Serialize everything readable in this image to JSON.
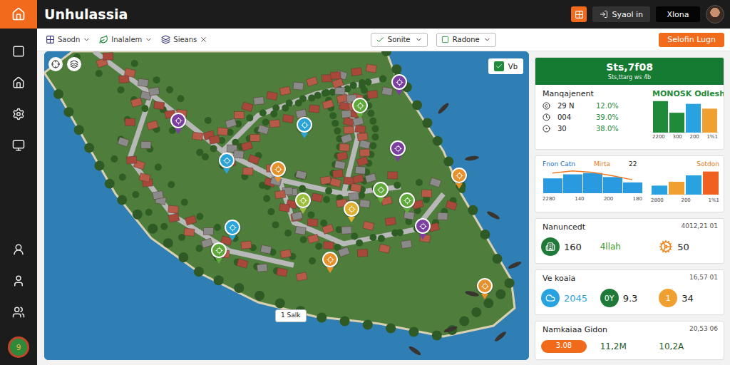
{
  "app": {
    "title": "Unhulassia",
    "badge": "9"
  },
  "header": {
    "signin": "Syaol in",
    "user": "Xlona"
  },
  "toolbar": {
    "filters": [
      {
        "label": "Saodn"
      },
      {
        "label": "Inalalem"
      },
      {
        "label": "Sieans"
      }
    ],
    "dropdowns": [
      {
        "label": "Sonite"
      },
      {
        "label": "Radone"
      }
    ],
    "action": "Selofin Lugn"
  },
  "map": {
    "badge": "Vb",
    "label": "1 Salk",
    "pins": [
      {
        "color": "#7b3fa0"
      },
      {
        "color": "#29a3d8"
      },
      {
        "color": "#5fa83a"
      },
      {
        "color": "#7b3fa0"
      },
      {
        "color": "#7b3fa0"
      },
      {
        "color": "#29a3d8"
      },
      {
        "color": "#e8902a"
      },
      {
        "color": "#9bbf3a"
      },
      {
        "color": "#e0b030"
      },
      {
        "color": "#5fa83a"
      },
      {
        "color": "#5fa83a"
      },
      {
        "color": "#7b3fa0"
      },
      {
        "color": "#e8902a"
      },
      {
        "color": "#29a3d8"
      },
      {
        "color": "#e8902a"
      },
      {
        "color": "#e8902a"
      },
      {
        "color": "#5fa83a"
      }
    ]
  },
  "summary": {
    "title": "Sts,7f08",
    "subtitle": "Sts,ttarg ws 4b",
    "heading": "Manqajenent",
    "column": "MONOSK Odlesh",
    "rows": [
      {
        "value": "29 N",
        "percent": "12.0%"
      },
      {
        "value": "004",
        "percent": "39.0%"
      },
      {
        "value": "30",
        "percent": "38.0%"
      }
    ],
    "chart": {
      "values": [
        46,
        29,
        42,
        35
      ],
      "colors": [
        "#1f8a3a",
        "#1f8a3a",
        "#29a3e0",
        "#f0a030"
      ],
      "ticks": [
        "2200",
        "300",
        "200",
        "1%1"
      ]
    }
  },
  "trend": {
    "title": "Fnon Catn",
    "series": "Mirta",
    "value": "22",
    "bars": [
      22,
      28,
      30,
      24,
      16
    ],
    "line": [
      30,
      33,
      31,
      26,
      20
    ],
    "ticks": [
      "2280",
      "140",
      "200",
      "180"
    ],
    "side": {
      "title": "Sotdon",
      "values": [
        14,
        20,
        30,
        36
      ],
      "colors": [
        "#29a3e0",
        "#f0a030",
        "#29a3e0",
        "#f06020"
      ],
      "ticks": [
        "2800",
        "200",
        "1%1"
      ]
    }
  },
  "cards": [
    {
      "title": "Nanuncedt",
      "date": "4012,21 01",
      "items": [
        {
          "kind": "icon",
          "value": "160",
          "color": "#1f7a3a"
        },
        {
          "kind": "text",
          "value": "4llah",
          "color": "#3c9a2a"
        },
        {
          "kind": "gear",
          "value": "50",
          "color": "#f08a20"
        }
      ]
    },
    {
      "title": "Ve koaia",
      "date": "16,57 01",
      "items": [
        {
          "kind": "icon",
          "value": "2045",
          "color": "#29a3e0"
        },
        {
          "kind": "badge",
          "mark": "0Y",
          "value": "9.3",
          "color": "#1f7a3a"
        },
        {
          "kind": "badge",
          "mark": "1",
          "value": "34",
          "color": "#f0a030"
        }
      ]
    },
    {
      "title": "Namkaiaa Gidon",
      "date": "20,53 06",
      "items": [
        {
          "kind": "pill",
          "mark": "3.08",
          "color": "#f06a1a"
        },
        {
          "kind": "text",
          "value": "11,2M",
          "color": "#1f5a2a"
        },
        {
          "kind": "text",
          "value": "10,2A",
          "color": "#1f5a2a"
        }
      ]
    }
  ]
}
